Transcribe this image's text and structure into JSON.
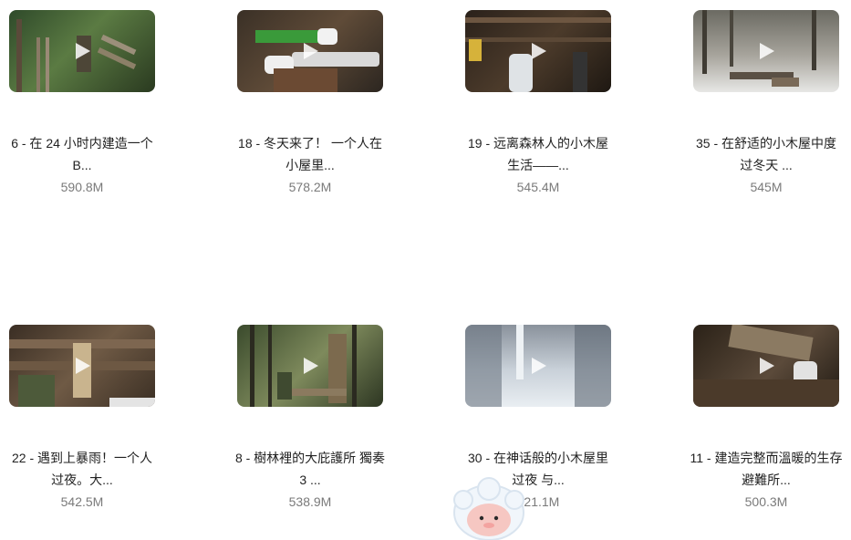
{
  "videos": [
    {
      "title_l1": "6 - 在 24 小时内建造一个",
      "title_l2": "B...",
      "views": "590.8M"
    },
    {
      "title_l1": "18 - 冬天来了！ 一个人在",
      "title_l2": "小屋里...",
      "views": "578.2M"
    },
    {
      "title_l1": "19 - 远离森林人的小木屋",
      "title_l2": "生活——...",
      "views": "545.4M"
    },
    {
      "title_l1": "35 - 在舒适的小木屋中度",
      "title_l2": "过冬天 ...",
      "views": "545M"
    },
    {
      "title_l1": "22 - 遇到上暴雨！一个人",
      "title_l2": "过夜。大...",
      "views": "542.5M"
    },
    {
      "title_l1": "8 - 樹林裡的大庇護所 獨奏",
      "title_l2": "3 ...",
      "views": "538.9M"
    },
    {
      "title_l1": "30 - 在神话般的小木屋里",
      "title_l2": "过夜 与...",
      "views": "521.1M"
    },
    {
      "title_l1": "11 - 建造完整而溫暖的生存",
      "title_l2": "避難所...",
      "views": "500.3M"
    }
  ],
  "icons": {
    "play": "play-icon",
    "mascot": "mascot-avatar-icon"
  }
}
